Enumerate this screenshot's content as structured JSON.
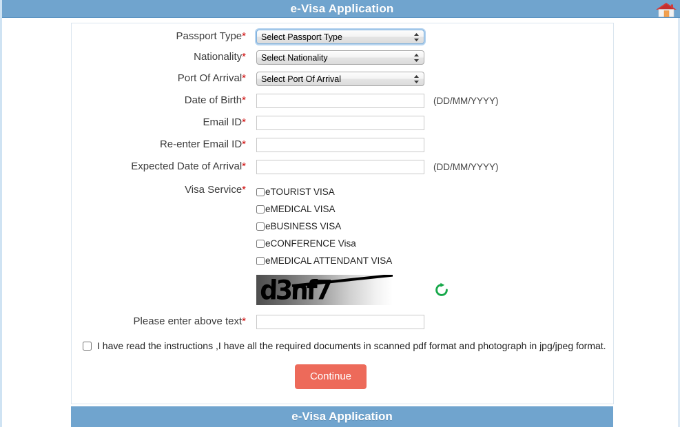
{
  "header": {
    "title": "e-Visa Application",
    "home_icon": "home-icon",
    "background_color": "#70a4ce"
  },
  "footer": {
    "title": "e-Visa Application",
    "background_color": "#70a4ce"
  },
  "form": {
    "required_marker": "*",
    "fields": [
      {
        "label": "Passport Type",
        "required": true,
        "type": "select",
        "selected": "Select Passport Type",
        "focused": true,
        "hint": ""
      },
      {
        "label": "Nationality",
        "required": true,
        "type": "select",
        "selected": "Select Nationality",
        "focused": false,
        "hint": ""
      },
      {
        "label": "Port Of Arrival",
        "required": true,
        "type": "select",
        "selected": "Select Port Of Arrival",
        "focused": false,
        "hint": ""
      },
      {
        "label": "Date of Birth",
        "required": true,
        "type": "text",
        "value": "",
        "placeholder": "",
        "hint": "(DD/MM/YYYY)"
      },
      {
        "label": "Email ID",
        "required": true,
        "type": "text",
        "value": "",
        "placeholder": "",
        "hint": ""
      },
      {
        "label": "Re-enter Email ID",
        "required": true,
        "type": "text",
        "value": "",
        "placeholder": "",
        "hint": ""
      },
      {
        "label": "Expected Date of Arrival",
        "required": true,
        "type": "text",
        "value": "",
        "placeholder": "",
        "hint": "(DD/MM/YYYY)"
      }
    ],
    "visa_service": {
      "label": "Visa Service",
      "required": true,
      "options": [
        {
          "label": "eTOURIST VISA",
          "checked": false
        },
        {
          "label": "eMEDICAL VISA",
          "checked": false
        },
        {
          "label": "eBUSINESS VISA",
          "checked": false
        },
        {
          "label": "eCONFERENCE Visa",
          "checked": false
        },
        {
          "label": "eMEDICAL ATTENDANT VISA",
          "checked": false
        }
      ]
    },
    "captcha": {
      "text": "d3nf7",
      "refresh_icon": "refresh-icon",
      "refresh_color": "#17a84a"
    },
    "captcha_input": {
      "label": "Please enter above text",
      "required": true,
      "value": "",
      "placeholder": ""
    },
    "declaration": {
      "text": "I have read the instructions ,I have all the required documents in scanned pdf format and photograph in jpg/jpeg format.",
      "checked": false
    },
    "submit": {
      "label": "Continue",
      "color": "#ed6a5a"
    }
  }
}
